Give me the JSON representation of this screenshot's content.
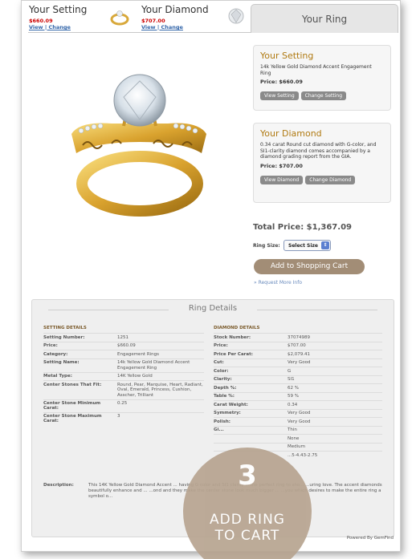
{
  "tabs": {
    "setting": {
      "title": "Your Setting",
      "price": "$660.09",
      "links": "View | Change"
    },
    "diamond": {
      "title": "Your Diamond",
      "price": "$707.00",
      "links": "View | Change"
    },
    "ring": {
      "title": "Your Ring"
    }
  },
  "setting_card": {
    "title": "Your Setting",
    "desc": "14k Yellow Gold Diamond Accent Engagement Ring",
    "price": "Price: $660.09",
    "btn_view": "View Setting",
    "btn_change": "Change Setting"
  },
  "diamond_card": {
    "title": "Your Diamond",
    "desc": "0.34 carat Round cut diamond with G-color, and SI1-clarity diamond comes accompanied by a diamond grading report from the GIA.",
    "price": "Price: $707.00",
    "btn_view": "View Diamond",
    "btn_change": "Change Diamond"
  },
  "total": "Total Price: $1,367.09",
  "ring_size": {
    "label": "Ring Size:",
    "value": "Select Size"
  },
  "add_to_cart": "Add to Shopping Cart",
  "request_info": "» Request More Info",
  "details": {
    "title": "Ring Details",
    "setting_head": "SETTING DETAILS",
    "setting_rows": [
      {
        "k": "Setting Number:",
        "v": "1251"
      },
      {
        "k": "Price:",
        "v": "$660.09"
      },
      {
        "k": "Category:",
        "v": "Engagement Rings"
      },
      {
        "k": "Setting Name:",
        "v": "14k Yellow Gold Diamond Accent Engagement Ring"
      },
      {
        "k": "Metal Type:",
        "v": "14K Yellow Gold"
      },
      {
        "k": "Center Stones That Fit:",
        "v": "Round, Pear, Marquise, Heart, Radiant, Oval, Emerald, Princess, Cushion, Asscher, Trilliant"
      },
      {
        "k": "Center Stone Minimum Carat:",
        "v": "0.25"
      },
      {
        "k": "Center Stone Maximum Carat:",
        "v": "3"
      }
    ],
    "diamond_head": "DIAMOND DETAILS",
    "diamond_rows": [
      {
        "k": "Stock Number:",
        "v": "37074989"
      },
      {
        "k": "Price:",
        "v": "$707.00"
      },
      {
        "k": "Price Per Carat:",
        "v": "$2,079.41"
      },
      {
        "k": "Cut:",
        "v": "Very Good"
      },
      {
        "k": "Color:",
        "v": "G"
      },
      {
        "k": "Clarity:",
        "v": "SI1"
      },
      {
        "k": "Depth %:",
        "v": "62 %"
      },
      {
        "k": "Table %:",
        "v": "59 %"
      },
      {
        "k": "Carat Weight:",
        "v": "0.34"
      },
      {
        "k": "Symmetry:",
        "v": "Very Good"
      },
      {
        "k": "Polish:",
        "v": "Very Good"
      },
      {
        "k": "Gi...",
        "v": "Thin"
      },
      {
        "k": "",
        "v": "None"
      },
      {
        "k": "",
        "v": "Medium"
      },
      {
        "k": "",
        "v": "...5-4.43-2.75"
      }
    ],
    "desc_label": "Description:",
    "desc_text": "This 14K Yellow Gold Diamond Accent ... having G color and SI1 clarity is the perfect ring to sho... ...uring love. The accent diamonds beautifully enhance and ... ...ond and they make the center stone look much bigger ... ...you which desires to make the entire ring a symbol o..."
  },
  "powered": "Powered By GemFind",
  "badge": {
    "number": "3",
    "line1": "ADD RING",
    "line2": "TO CART"
  },
  "colors": {
    "accent": "#b07a12",
    "price": "#cc0000",
    "button": "#a28d76",
    "badge": "#b7a490"
  }
}
